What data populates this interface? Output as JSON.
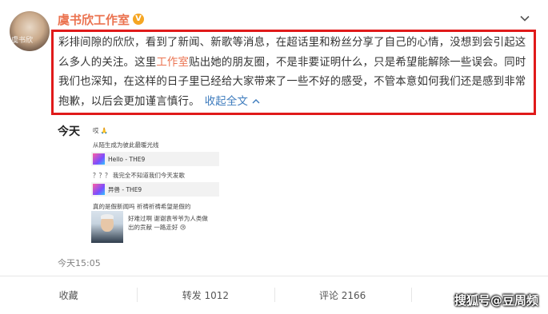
{
  "post": {
    "author": "虞书欣工作室",
    "avatar_watermark": "虞书欣",
    "content_part1": "彩排间隙的欣欣，看到了新闻、新歌等消息，在超话里和粉丝分享了自己的心情，没想到会引起这么多人的关注。这里",
    "content_highlight": "工作室",
    "content_part2": "贴出她的朋友圈，不是非要证明什么，只是希望能解除一些误会。同时我们也深知，在这样的日子里已经给大家带来了一些不好的感受，不管本意如何我们还是感到非常抱歉，以后会更加谨言慎行。",
    "collapse_label": "收起全文",
    "timestamp": "今天15:05",
    "accent_color": "#eb7350"
  },
  "embed": {
    "title": "今天",
    "line1": "哎 🙏",
    "line2": "从陌生成为彼此最暖光线",
    "card1": "Hello - THE9",
    "line3": "？？？ 我完全不知道我们今天发歌",
    "card2": "异兽 - THE9",
    "line4": "真的是假新闻吗 祈祷祈祷希望是假的",
    "line5a": "好难过啊 谢谢袁爷爷为人类做",
    "line5b": "出的贡献 一路走好 😢"
  },
  "actions": {
    "favorite": "收藏",
    "repost": "转发 1012",
    "comment": "评论 2166"
  },
  "watermark": "搜狐号@豆周频"
}
